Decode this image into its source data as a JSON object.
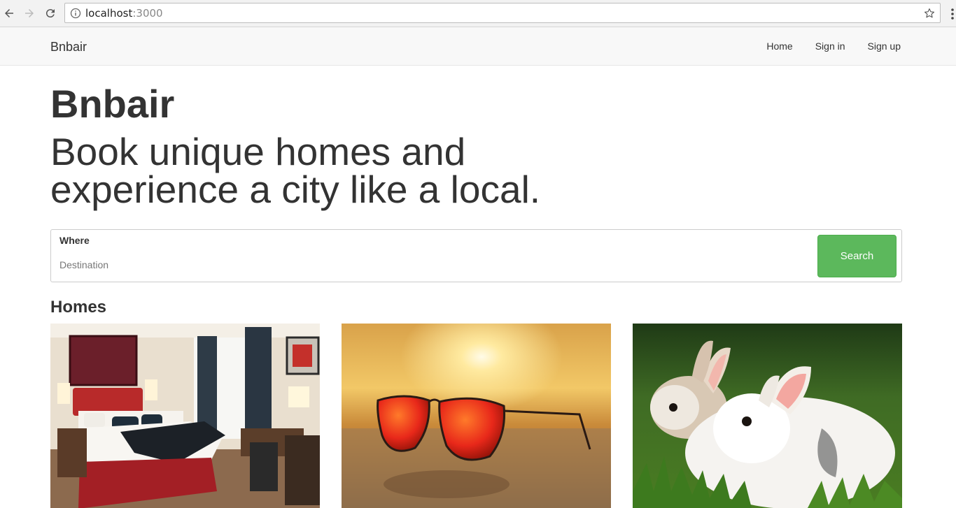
{
  "browser": {
    "url_host": "localhost",
    "url_port": ":3000",
    "back_icon": "arrow-left-icon",
    "forward_icon": "arrow-right-icon",
    "reload_icon": "reload-icon",
    "info_icon": "info-icon",
    "bookmark_icon": "star-icon",
    "menu_icon": "more-vert-icon"
  },
  "navbar": {
    "brand": "Bnbair",
    "links": [
      {
        "label": "Home"
      },
      {
        "label": "Sign in"
      },
      {
        "label": "Sign up"
      }
    ]
  },
  "hero": {
    "title": "Bnbair",
    "subtitle": "Book unique homes and experience a city like a local."
  },
  "search": {
    "label": "Where",
    "placeholder": "Destination",
    "value": "",
    "button": "Search",
    "button_color": "#5cb85c"
  },
  "homes": {
    "title": "Homes",
    "items": [
      {
        "image": "hotel-bedroom-photo"
      },
      {
        "image": "sunglasses-beach-sunset-photo"
      },
      {
        "image": "bunnies-grass-photo"
      }
    ]
  }
}
